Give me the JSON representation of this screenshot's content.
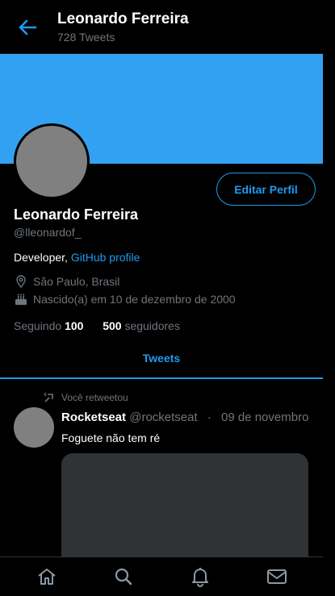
{
  "header": {
    "title": "Leonardo Ferreira",
    "subtitle": "728 Tweets",
    "back_icon": "arrow-left-icon"
  },
  "colors": {
    "accent": "#1d9bf0",
    "banner": "#33a1f2",
    "avatar_placeholder": "#808080",
    "muted": "#6e767d"
  },
  "profile": {
    "edit_button": "Editar Perfil",
    "name": "Leonardo Ferreira",
    "handle": "@lleonardof_",
    "bio_text": "Developer, ",
    "bio_link": "GitHub profile",
    "location": "São Paulo, Brasil",
    "birthday": "Nascido(a) em 10 de dezembro de 2000",
    "following_label": "Seguindo",
    "following_count": "100",
    "followers_count": "500",
    "followers_label": "seguidores"
  },
  "tabs": [
    {
      "label": "Tweets",
      "active": true
    }
  ],
  "tweet": {
    "retweet_note": "Você retweetou",
    "author_name": "Rocketseat",
    "author_handle": "@rocketseat",
    "separator": "·",
    "date": "09 de novembro",
    "text": "Foguete não tem ré"
  },
  "bottom_nav": [
    "home-icon",
    "search-icon",
    "bell-icon",
    "mail-icon"
  ]
}
